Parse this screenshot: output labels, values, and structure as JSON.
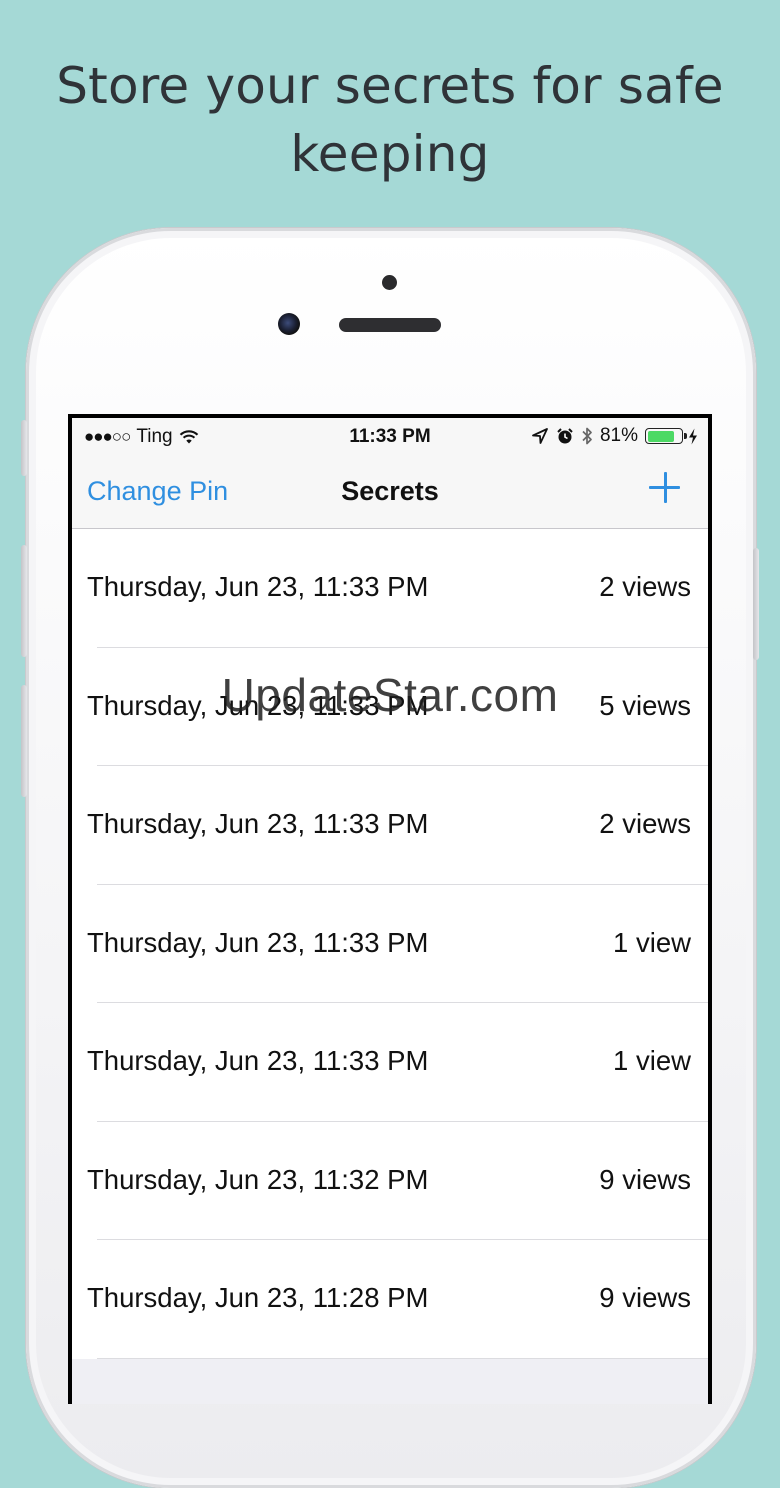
{
  "headline": "Store your secrets for safe keeping",
  "status_bar": {
    "signal_dots": "●●●○○",
    "carrier": "Ting",
    "time": "11:33 PM",
    "battery_percent": "81%",
    "battery_level": 0.81
  },
  "nav": {
    "left_button": "Change Pin",
    "title": "Secrets",
    "right_icon": "plus-icon"
  },
  "rows": [
    {
      "date": "Thursday, Jun 23, 11:33 PM",
      "views": "2 views"
    },
    {
      "date": "Thursday, Jun 23, 11:33 PM",
      "views": "5 views"
    },
    {
      "date": "Thursday, Jun 23, 11:33 PM",
      "views": "2 views"
    },
    {
      "date": "Thursday, Jun 23, 11:33 PM",
      "views": "1 view"
    },
    {
      "date": "Thursday, Jun 23, 11:33 PM",
      "views": "1 view"
    },
    {
      "date": "Thursday, Jun 23, 11:32 PM",
      "views": "9 views"
    },
    {
      "date": "Thursday, Jun 23, 11:28 PM",
      "views": "9 views"
    }
  ],
  "watermark": "UpdateStar.com",
  "colors": {
    "background": "#a5d9d6",
    "accent": "#2f8fe0",
    "battery": "#4cd964"
  }
}
